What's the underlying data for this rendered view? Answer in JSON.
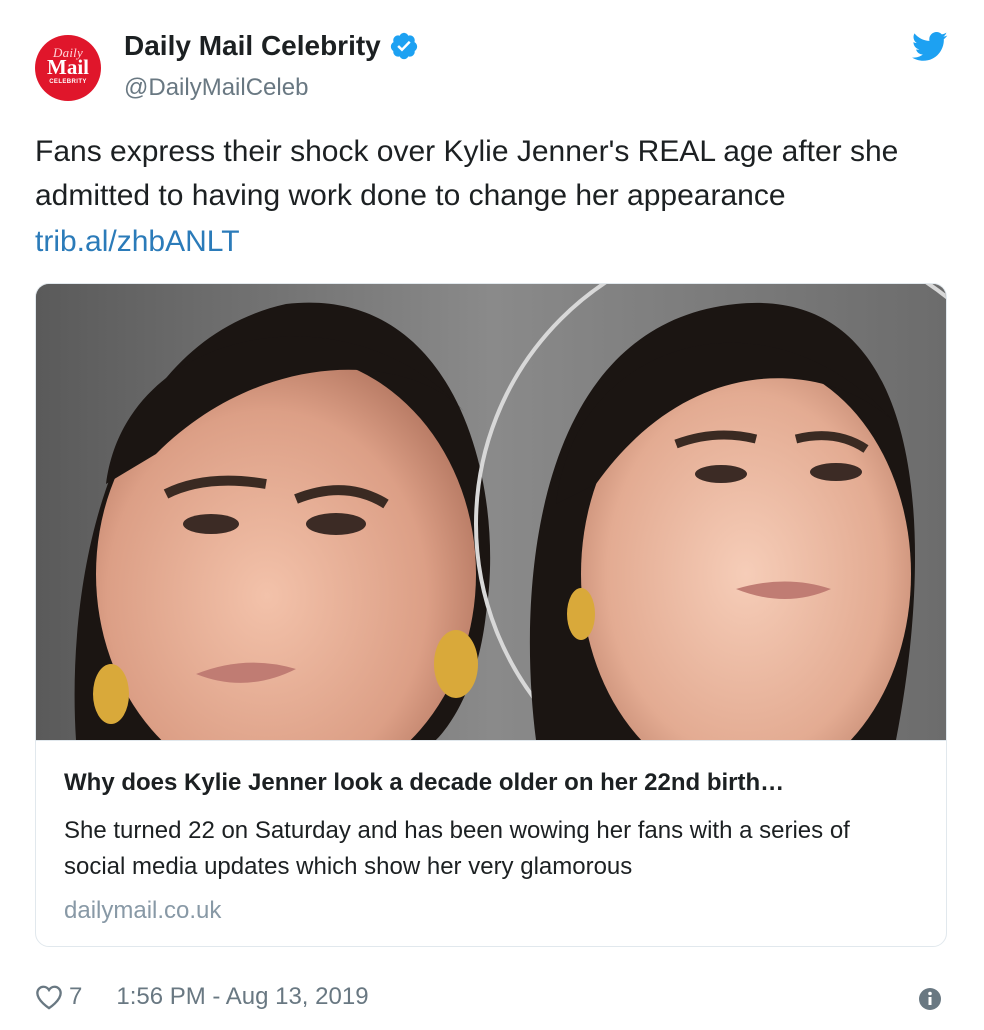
{
  "author": {
    "display_name": "Daily Mail Celebrity",
    "handle": "@DailyMailCeleb",
    "avatar_line1": "Daily",
    "avatar_line2": "Mail",
    "avatar_line3": "CELEBRITY",
    "verified": true
  },
  "tweet": {
    "text": "Fans express their shock over Kylie Jenner's REAL age after she admitted to having work done to change her appearance",
    "link": "trib.al/zhbANLT"
  },
  "card": {
    "title": "Why does Kylie Jenner look a decade older on her 22nd birth…",
    "description": "She turned 22 on Saturday and has been wowing her fans with a series of social media updates which show her very glamorous",
    "domain": "dailymail.co.uk"
  },
  "footer": {
    "likes": "7",
    "timestamp": "1:56 PM - Aug 13, 2019"
  },
  "icons": {
    "brand": "twitter-bird-icon",
    "verified": "verified-badge-icon",
    "like": "heart-icon",
    "info": "info-icon"
  },
  "colors": {
    "brand_blue": "#1da1f2",
    "link": "#2b7bb9",
    "avatar_red": "#e0162b",
    "muted": "#697882"
  }
}
